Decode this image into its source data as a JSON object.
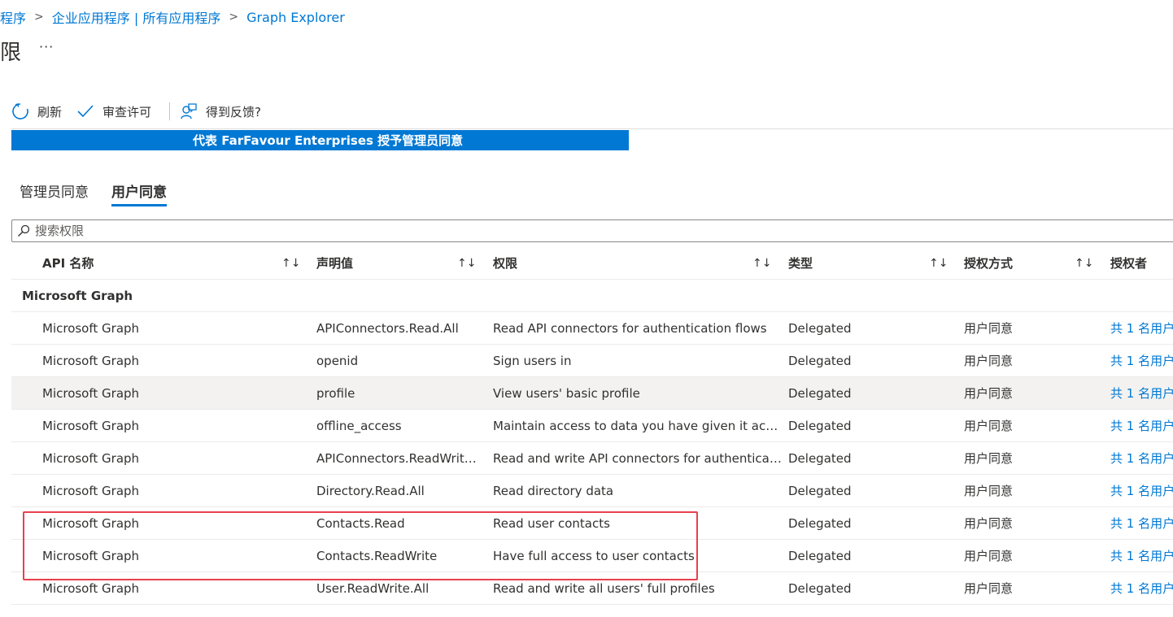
{
  "breadcrumb": {
    "items": [
      "程序",
      "企业应用程序 | 所有应用程序",
      "Graph Explorer"
    ],
    "separator": ">"
  },
  "page": {
    "title": "限",
    "more": "···"
  },
  "toolbar": {
    "refresh_label": "刷新",
    "review_label": "审查许可",
    "feedback_label": "得到反馈?"
  },
  "grant_button": {
    "label": "代表 FarFavour Enterprises 授予管理员同意"
  },
  "tabs": [
    {
      "label": "管理员同意",
      "active": false
    },
    {
      "label": "用户同意",
      "active": true
    }
  ],
  "search": {
    "placeholder": "搜索权限",
    "value": ""
  },
  "table": {
    "columns": [
      "API 名称",
      "声明值",
      "权限",
      "类型",
      "授权方式",
      "授权者"
    ],
    "sort_icon": "↑↓",
    "group": "Microsoft Graph",
    "rows": [
      {
        "api": "Microsoft Graph",
        "claim": "APIConnectors.Read.All",
        "permission": "Read API connectors for authentication flows",
        "type": "Delegated",
        "grant": "用户同意",
        "granted_by": "共 1 名用户"
      },
      {
        "api": "Microsoft Graph",
        "claim": "openid",
        "permission": "Sign users in",
        "type": "Delegated",
        "grant": "用户同意",
        "granted_by": "共 1 名用户"
      },
      {
        "api": "Microsoft Graph",
        "claim": "profile",
        "permission": "View users' basic profile",
        "type": "Delegated",
        "grant": "用户同意",
        "granted_by": "共 1 名用户"
      },
      {
        "api": "Microsoft Graph",
        "claim": "offline_access",
        "permission": "Maintain access to data you have given it access to",
        "type": "Delegated",
        "grant": "用户同意",
        "granted_by": "共 1 名用户"
      },
      {
        "api": "Microsoft Graph",
        "claim": "APIConnectors.ReadWrite.All",
        "permission": "Read and write API connectors for authentication flows",
        "type": "Delegated",
        "grant": "用户同意",
        "granted_by": "共 1 名用户"
      },
      {
        "api": "Microsoft Graph",
        "claim": "Directory.Read.All",
        "permission": "Read directory data",
        "type": "Delegated",
        "grant": "用户同意",
        "granted_by": "共 1 名用户"
      },
      {
        "api": "Microsoft Graph",
        "claim": "Contacts.Read",
        "permission": "Read user contacts",
        "type": "Delegated",
        "grant": "用户同意",
        "granted_by": "共 1 名用户"
      },
      {
        "api": "Microsoft Graph",
        "claim": "Contacts.ReadWrite",
        "permission": "Have full access to user contacts",
        "type": "Delegated",
        "grant": "用户同意",
        "granted_by": "共 1 名用户"
      },
      {
        "api": "Microsoft Graph",
        "claim": "User.ReadWrite.All",
        "permission": "Read and write all users' full profiles",
        "type": "Delegated",
        "grant": "用户同意",
        "granted_by": "共 1 名用户"
      }
    ]
  },
  "icons": {
    "refresh": "refresh-icon",
    "review": "checkmark-icon",
    "feedback": "feedback-icon",
    "search": "search-icon"
  },
  "colors": {
    "accent": "#0078d4",
    "highlight": "#e8404f",
    "text": "#323130"
  }
}
